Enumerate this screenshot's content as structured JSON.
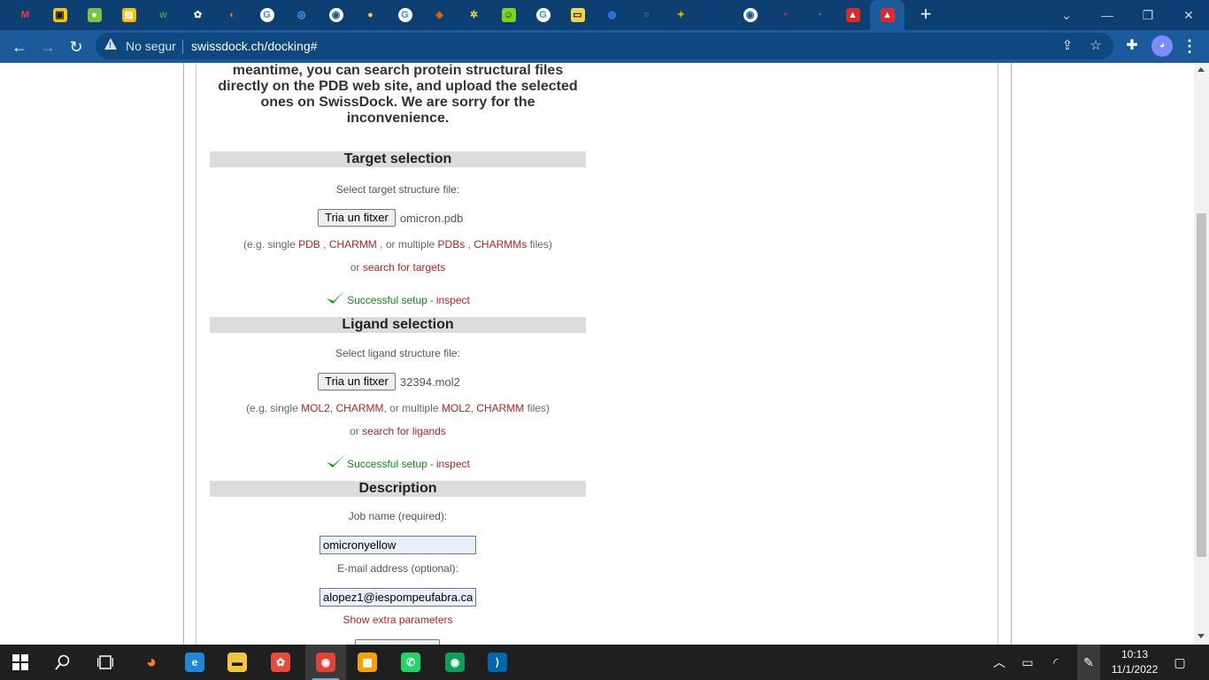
{
  "browser": {
    "tabs": [
      {
        "icon": "gmail-icon",
        "glyph": "M",
        "color": "#e94235",
        "bg": "transparent"
      },
      {
        "icon": "image-app-icon",
        "glyph": "▣",
        "color": "#1a1a1a",
        "bg": "#f7c21a"
      },
      {
        "icon": "android-icon",
        "glyph": "●",
        "color": "#ffffff",
        "bg": "#7cc243"
      },
      {
        "icon": "keep-icon",
        "glyph": "▤",
        "color": "#ffffff",
        "bg": "#fbbc04"
      },
      {
        "icon": "wikidot-icon",
        "glyph": "w",
        "color": "#33a853",
        "bg": "transparent"
      },
      {
        "icon": "bug-icon",
        "glyph": "✿",
        "color": "#ffffff",
        "bg": "transparent"
      },
      {
        "icon": "jupyter-icon",
        "glyph": "◐",
        "color": "#f37726",
        "bg": "transparent"
      },
      {
        "icon": "google-icon",
        "glyph": "G",
        "color": "#4285f4",
        "bg": "#ffffff"
      },
      {
        "icon": "compass-icon",
        "glyph": "◎",
        "color": "#4aa3ff",
        "bg": "transparent"
      },
      {
        "icon": "globe-icon",
        "glyph": "◉",
        "color": "#1b5a9b",
        "bg": "#ffffff"
      },
      {
        "icon": "sun-icon",
        "glyph": "●",
        "color": "#f2c94c",
        "bg": "transparent"
      },
      {
        "icon": "google-icon",
        "glyph": "G",
        "color": "#4285f4",
        "bg": "#ffffff"
      },
      {
        "icon": "fox-icon",
        "glyph": "◆",
        "color": "#e85d04",
        "bg": "transparent"
      },
      {
        "icon": "atom-icon",
        "glyph": "✲",
        "color": "#ffd54f",
        "bg": "transparent"
      },
      {
        "icon": "smiley-icon",
        "glyph": "☺",
        "color": "#1a1a1a",
        "bg": "#7ed321"
      },
      {
        "icon": "google-icon",
        "glyph": "G",
        "color": "#4285f4",
        "bg": "#ffffff"
      },
      {
        "icon": "note-icon",
        "glyph": "▭",
        "color": "#1a1a1a",
        "bg": "#f5d547"
      },
      {
        "icon": "target-icon",
        "glyph": "◍",
        "color": "#3d7bff",
        "bg": "transparent"
      },
      {
        "icon": "ring-icon",
        "glyph": "○",
        "color": "#26c24b",
        "bg": "transparent"
      },
      {
        "icon": "runner-icon",
        "glyph": "✦",
        "color": "#f0a500",
        "bg": "transparent"
      },
      {
        "icon": "nasa-icon",
        "glyph": "●",
        "color": "#0b3d91",
        "bg": "transparent"
      },
      {
        "icon": "globe-icon",
        "glyph": "◉",
        "color": "#1b5a9b",
        "bg": "#ffffff"
      },
      {
        "icon": "arc-icon",
        "glyph": "◔",
        "color": "#e94235",
        "bg": "transparent"
      },
      {
        "icon": "arc-icon",
        "glyph": "◔",
        "color": "#4285f4",
        "bg": "transparent"
      },
      {
        "icon": "swissdock-icon",
        "glyph": "▲",
        "color": "#ffffff",
        "bg": "#d92b2b"
      },
      {
        "icon": "swissdock-icon",
        "glyph": "▲",
        "color": "#ffffff",
        "bg": "#d92b2b"
      }
    ],
    "new_tab_label": "+",
    "security_label": "No segur",
    "url": "swissdock.ch/docking#"
  },
  "page": {
    "notice": [
      "meantime, you can search protein structural files",
      "directly on the PDB web site, and upload the selected",
      "ones on SwissDock. We are sorry for the",
      "inconvenience."
    ],
    "target": {
      "heading": "Target selection",
      "select_label": "Select target structure file:",
      "file_button": "Tria un fitxer",
      "file_name": "omicron.pdb",
      "hint_prefix": "(e.g. single",
      "hint_pdb": "PDB",
      "hint_comma1": ",",
      "hint_charmm": "CHARMM",
      "hint_mid": ", or multiple",
      "hint_pdbs": "PDBs",
      "hint_comma2": ",",
      "hint_charmms": "CHARMMs",
      "hint_suffix": "files)",
      "or_label": "or",
      "search_link": "search for targets",
      "status": "Successful setup",
      "status_sep": "-",
      "inspect_link": "inspect"
    },
    "ligand": {
      "heading": "Ligand selection",
      "select_label": "Select ligand structure file:",
      "file_button": "Tria un fitxer",
      "file_name": "32394.mol2",
      "hint_prefix": "(e.g. single",
      "hint_mol2": "MOL2",
      "hint_comma1": ",",
      "hint_charmm": "CHARMM",
      "hint_mid": ", or multiple",
      "hint_mol2s": "MOL2",
      "hint_comma2": ",",
      "hint_charmms": "CHARMM",
      "hint_suffix": "files)",
      "or_label": "or",
      "search_link": "search for ligands",
      "status": "Successful setup",
      "status_sep": "-",
      "inspect_link": "inspect"
    },
    "description": {
      "heading": "Description",
      "job_label": "Job name (required):",
      "job_value": "omicronyellow",
      "email_label": "E-mail address (optional):",
      "email_value": "alopez1@iespompeufabra.cat",
      "extra_link": "Show extra parameters"
    }
  },
  "taskbar": {
    "apps": [
      {
        "icon": "firefox-icon",
        "glyph": "◕",
        "color": "#ff7139",
        "bg": "transparent",
        "active": false
      },
      {
        "icon": "edge-icon",
        "glyph": "e",
        "color": "#ffffff",
        "bg": "#1e88d6",
        "active": false
      },
      {
        "icon": "file-explorer-icon",
        "glyph": "▬",
        "color": "#1a1a1a",
        "bg": "#f5c542",
        "active": false
      },
      {
        "icon": "photos-icon",
        "glyph": "✿",
        "color": "#ffffff",
        "bg": "#e84b3c",
        "active": false
      },
      {
        "icon": "chrome-icon",
        "glyph": "◉",
        "color": "#ffffff",
        "bg": "#db4437",
        "active": true
      },
      {
        "icon": "store-icon",
        "glyph": "▦",
        "color": "#ffffff",
        "bg": "#f0a30a",
        "active": false
      },
      {
        "icon": "whatsapp-icon",
        "glyph": "✆",
        "color": "#ffffff",
        "bg": "#25d366",
        "active": false
      },
      {
        "icon": "chrome-profile-icon",
        "glyph": "◉",
        "color": "#ffffff",
        "bg": "#0f9d58",
        "active": false
      },
      {
        "icon": "vscode-icon",
        "glyph": "⟩",
        "color": "#ffffff",
        "bg": "#0065a9",
        "active": false
      }
    ],
    "time": "10:13",
    "date": "11/1/2022"
  }
}
